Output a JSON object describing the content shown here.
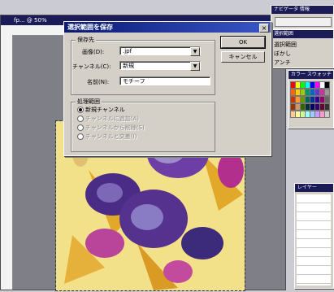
{
  "document": {
    "title": "fp... @ 50%"
  },
  "dialog": {
    "title": "選択範囲を保存",
    "dest_group": "保存先",
    "doc_label": "画像(D):",
    "doc_value": ".jpf",
    "channel_label": "チャンネル(C):",
    "channel_value": "新規",
    "name_label": "名前(N):",
    "name_value": "モチーフ",
    "op_group": "処理範囲",
    "options": [
      {
        "label": "新規チャンネル",
        "selected": true,
        "enabled": true
      },
      {
        "label": "チャンネルに追加(A)",
        "selected": false,
        "enabled": false
      },
      {
        "label": "チャンネルから削除(S)",
        "selected": false,
        "enabled": false
      },
      {
        "label": "チャンネルと交差(I)",
        "selected": false,
        "enabled": false
      }
    ],
    "ok": "OK",
    "cancel": "キャンセル"
  },
  "panels": {
    "top_tabs": "ナビゲータ  情報",
    "tool_tab": "選択範囲",
    "tool_rows": [
      "選択範囲",
      "ぼかし",
      "アンチ"
    ],
    "swatches_tab": "カラー  スウォッチ",
    "layers_tab": "レイヤー"
  },
  "colors": {
    "swatch_rows": [
      [
        "#ff0000",
        "#ffff00",
        "#00ff00",
        "#00ffff",
        "#0000ff",
        "#ff00ff",
        "#ffffff",
        "#000000"
      ],
      [
        "#ff6600",
        "#ffcc00",
        "#99cc00",
        "#009966",
        "#0066cc",
        "#6633cc",
        "#cc3399",
        "#999999"
      ],
      [
        "#cc3300",
        "#ff9933",
        "#669900",
        "#006666",
        "#003399",
        "#330099",
        "#990066",
        "#666666"
      ],
      [
        "#993300",
        "#cc9966",
        "#336600",
        "#003333",
        "#000066",
        "#330066",
        "#660033",
        "#333333"
      ],
      [
        "#ffcc99",
        "#ffff99",
        "#ccff99",
        "#99ffff",
        "#99ccff",
        "#cc99ff",
        "#ff99cc",
        "#cccccc"
      ]
    ]
  }
}
